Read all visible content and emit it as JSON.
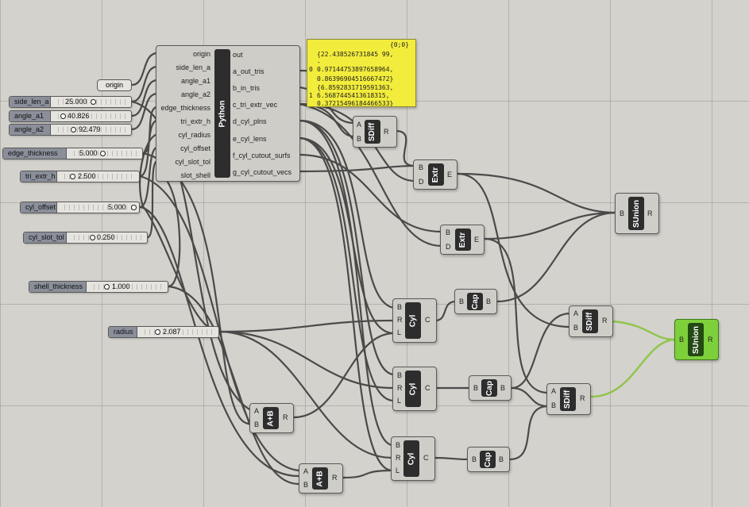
{
  "python": {
    "nickname": "Python",
    "inputs": [
      "origin",
      "side_len_a",
      "angle_a1",
      "angle_a2",
      "edge_thickness",
      "tri_extr_h",
      "cyl_radius",
      "cyl_offset",
      "cyl_slot_tol",
      "slot_shell"
    ],
    "outputs": [
      "out",
      "a_out_tris",
      "b_in_tris",
      "c_tri_extr_vec",
      "d_cyl_plns",
      "e_cyl_lens",
      "f_cyl_cutout_surfs",
      "g_cyl_cutout_vecs"
    ]
  },
  "origin_param": "origin",
  "sliders": {
    "side_len_a": {
      "label": "side_len_a",
      "value": "25.000"
    },
    "angle_a1": {
      "label": "angle_a1",
      "value": "40.826"
    },
    "angle_a2": {
      "label": "angle_a2",
      "value": "92.479"
    },
    "edge_thickness": {
      "label": "edge_thickness",
      "value": "5.000"
    },
    "tri_extr_h": {
      "label": "tri_extr_h",
      "value": "2.500"
    },
    "cyl_offset": {
      "label": "cyl_offset",
      "value": "5.000"
    },
    "cyl_slot_tol": {
      "label": "cyl_slot_tol",
      "value": "0.250"
    },
    "shell_thickness": {
      "label": "shell_thickness",
      "value": "1.000"
    },
    "radius": {
      "label": "radius",
      "value": "2.087"
    }
  },
  "panel": {
    "path": "{0;0}",
    "lines": [
      "{22.438526731845 99,",
      "-",
      "0.97144753897658964,",
      "0.86396904516667472}",
      "{6.8592831719591363,",
      "6.5687445413618315,",
      "0.37215496184466533}"
    ],
    "indices": [
      "0",
      "1"
    ]
  },
  "components": {
    "sdiff_top": {
      "nick": "SDiff",
      "in": [
        "A",
        "B"
      ],
      "out": [
        "R"
      ]
    },
    "extr_1": {
      "nick": "Extr",
      "in": [
        "B",
        "D"
      ],
      "out": [
        "E"
      ]
    },
    "extr_2": {
      "nick": "Extr",
      "in": [
        "B",
        "D"
      ],
      "out": [
        "E"
      ]
    },
    "sunion_top": {
      "nick": "SUnion",
      "in": [
        "B"
      ],
      "out": [
        "R"
      ]
    },
    "cyl_1": {
      "nick": "Cyl",
      "in": [
        "B",
        "R",
        "L"
      ],
      "out": [
        "C"
      ]
    },
    "cap_1": {
      "nick": "Cap",
      "in": [
        "B"
      ],
      "out": [
        "B"
      ]
    },
    "sdiff_mid": {
      "nick": "SDiff",
      "in": [
        "A",
        "B"
      ],
      "out": [
        "R"
      ]
    },
    "sunion_final": {
      "nick": "SUnion",
      "in": [
        "B"
      ],
      "out": [
        "R"
      ]
    },
    "cyl_2": {
      "nick": "Cyl",
      "in": [
        "B",
        "R",
        "L"
      ],
      "out": [
        "C"
      ]
    },
    "cap_2": {
      "nick": "Cap",
      "in": [
        "B"
      ],
      "out": [
        "B"
      ]
    },
    "sdiff_low": {
      "nick": "SDiff",
      "in": [
        "A",
        "B"
      ],
      "out": [
        "R"
      ]
    },
    "add_1": {
      "nick": "A+B",
      "in": [
        "A",
        "B"
      ],
      "out": [
        "R"
      ]
    },
    "cyl_3": {
      "nick": "Cyl",
      "in": [
        "B",
        "R",
        "L"
      ],
      "out": [
        "C"
      ]
    },
    "cap_3": {
      "nick": "Cap",
      "in": [
        "B"
      ],
      "out": [
        "B"
      ]
    },
    "add_2": {
      "nick": "A+B",
      "in": [
        "A",
        "B"
      ],
      "out": [
        "R"
      ]
    }
  },
  "colors": {
    "canvas": "#d4d2cc",
    "wire": "#4a4a4a",
    "wire_selected": "#8fc54a",
    "panel": "#f2ec3c",
    "selected_comp": "#7ed03b"
  }
}
